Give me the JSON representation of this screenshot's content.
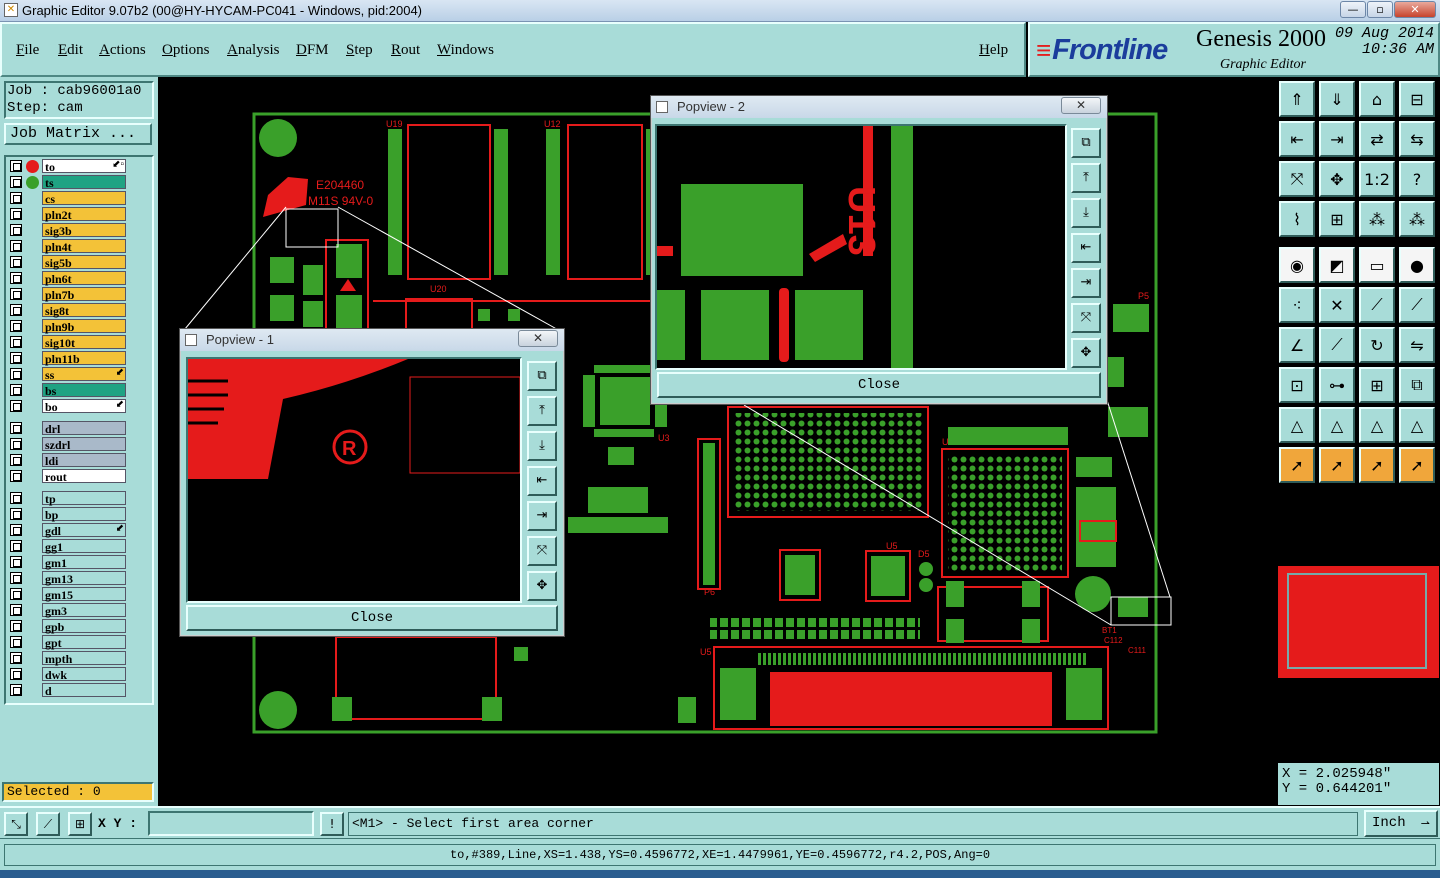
{
  "window": {
    "title": "Graphic Editor 9.07b2 (00@HY-HYCAM-PC041 - Windows, pid:2004)"
  },
  "menu": {
    "items": [
      {
        "label": "File"
      },
      {
        "label": "Edit"
      },
      {
        "label": "Actions"
      },
      {
        "label": "Options"
      },
      {
        "label": "Analysis"
      },
      {
        "label": "DFM"
      },
      {
        "label": "Step"
      },
      {
        "label": "Rout"
      },
      {
        "label": "Windows"
      }
    ],
    "help": "Help"
  },
  "branding": {
    "company": "Frontline",
    "product": "Genesis 2000",
    "subtitle": "Graphic Editor",
    "date": "09  Aug 2014",
    "time": "10:36 AM"
  },
  "job": {
    "job_line": "Job  : cab96001a0",
    "step_line": "Step: cam",
    "matrix_button": "Job Matrix ..."
  },
  "layers": [
    {
      "name": "to",
      "color": "#ffffff",
      "dot": "#e51b1b",
      "mark": "⬋▫"
    },
    {
      "name": "ts",
      "color": "#1fa383",
      "dot": "#3aa02a",
      "mark": ""
    },
    {
      "name": "cs",
      "color": "#f3c238",
      "mark": ""
    },
    {
      "name": "pln2t",
      "color": "#f3c238",
      "mark": ""
    },
    {
      "name": "sig3b",
      "color": "#f3c238",
      "mark": ""
    },
    {
      "name": "pln4t",
      "color": "#f3c238",
      "mark": ""
    },
    {
      "name": "sig5b",
      "color": "#f3c238",
      "mark": ""
    },
    {
      "name": "pln6t",
      "color": "#f3c238",
      "mark": ""
    },
    {
      "name": "pln7b",
      "color": "#f3c238",
      "mark": ""
    },
    {
      "name": "sig8t",
      "color": "#f3c238",
      "mark": ""
    },
    {
      "name": "pln9b",
      "color": "#f3c238",
      "mark": ""
    },
    {
      "name": "sig10t",
      "color": "#f3c238",
      "mark": ""
    },
    {
      "name": "pln11b",
      "color": "#f3c238",
      "mark": ""
    },
    {
      "name": "ss",
      "color": "#f3c238",
      "mark": "⬋"
    },
    {
      "name": "bs",
      "color": "#1fa383",
      "mark": ""
    },
    {
      "name": "bo",
      "color": "#ffffff",
      "mark": "⬋"
    },
    {
      "name": "drl",
      "color": "#a9b9c9",
      "mark": ""
    },
    {
      "name": "szdrl",
      "color": "#a9b9c9",
      "mark": ""
    },
    {
      "name": "ldi",
      "color": "#a9b9c9",
      "mark": ""
    },
    {
      "name": "rout",
      "color": "#ffffff",
      "mark": ""
    },
    {
      "name": "tp",
      "color": "#a8dcd8",
      "mark": ""
    },
    {
      "name": "bp",
      "color": "#a8dcd8",
      "mark": ""
    },
    {
      "name": "gdl",
      "color": "#a8dcd8",
      "mark": "⬋"
    },
    {
      "name": "gg1",
      "color": "#a8dcd8",
      "mark": ""
    },
    {
      "name": "gm1",
      "color": "#a8dcd8",
      "mark": ""
    },
    {
      "name": "gm13",
      "color": "#a8dcd8",
      "mark": ""
    },
    {
      "name": "gm15",
      "color": "#a8dcd8",
      "mark": ""
    },
    {
      "name": "gm3",
      "color": "#a8dcd8",
      "mark": ""
    },
    {
      "name": "gpb",
      "color": "#a8dcd8",
      "mark": ""
    },
    {
      "name": "gpt",
      "color": "#a8dcd8",
      "mark": ""
    },
    {
      "name": "mpth",
      "color": "#a8dcd8",
      "mark": ""
    },
    {
      "name": "dwk",
      "color": "#a8dcd8",
      "mark": ""
    },
    {
      "name": "d",
      "color": "#a8dcd8",
      "mark": ""
    }
  ],
  "selected": "Selected : 0",
  "popview1": {
    "title": "Popview - 1",
    "close_label": "Close"
  },
  "popview2": {
    "title": "Popview - 2",
    "close_label": "Close"
  },
  "pcb": {
    "silkscreen": [
      "E204460",
      "M11S 94V-0",
      "U19",
      "U12",
      "U20",
      "U3",
      "U4",
      "P6",
      "U5",
      "D5",
      "BT1",
      "C112",
      "C111",
      "C114",
      "P5"
    ]
  },
  "coordinates": {
    "x": "X  = 2.025948\"",
    "y": "Y  = 0.644201\""
  },
  "command": {
    "xy_label": "X Y :",
    "xy_value": "",
    "prompt": "<M1> - Select first area corner",
    "units": "Inch"
  },
  "status": "to,#389,Line,XS=1.438,YS=0.4596772,XE=1.4479961,YE=0.4596772,r4.2,POS,Ang=0",
  "colors": {
    "panel": "#a8dcd8",
    "copper_red": "#e51b1b",
    "pad_green": "#3aa02a",
    "outline_green": "#3aa02a"
  }
}
